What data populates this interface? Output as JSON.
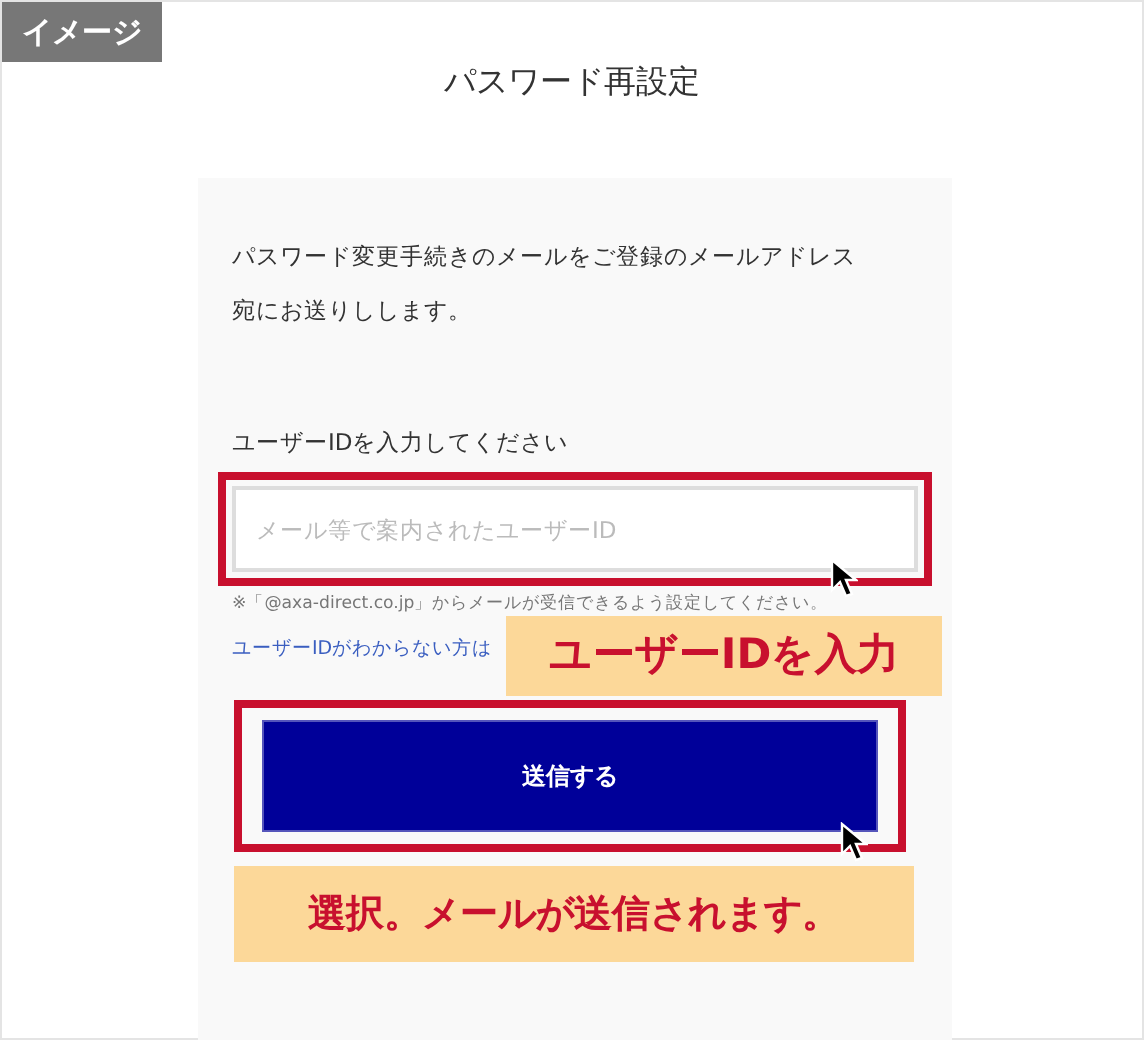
{
  "badge": "イメージ",
  "title": "パスワード再設定",
  "intro": "パスワード変更手続きのメールをご登録のメールアドレス宛にお送りしします。",
  "field": {
    "label": "ユーザーIDを入力してください",
    "placeholder": "メール等で案内されたユーザーID"
  },
  "note": "※「@axa-direct.co.jp」からメールが受信できるよう設定してください。",
  "help_link": "ユーザーIDがわからない方は",
  "submit_button": "送信する",
  "callouts": [
    {
      "text": "ユーザーIDを入力"
    },
    {
      "text": "選択。メールが送信されます。"
    }
  ]
}
